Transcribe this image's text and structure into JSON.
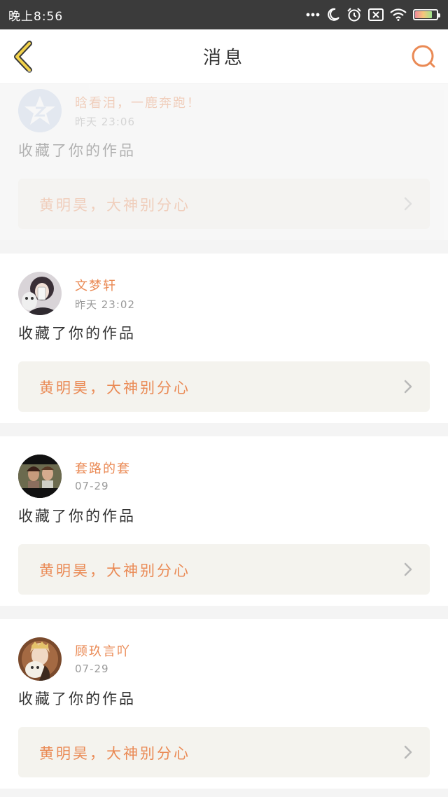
{
  "status_bar": {
    "time": "晚上8:56",
    "icons": [
      "more-dots-icon",
      "moon-icon",
      "alarm-icon",
      "sim-off-icon",
      "wifi-icon",
      "battery-icon"
    ],
    "battery_level": 0.8
  },
  "header": {
    "back_icon": "chevron-left-icon",
    "title": "消息",
    "search_icon": "search-icon"
  },
  "colors": {
    "accent": "#ea8a55",
    "back_arrow": "#f2d24b",
    "card_bg": "#ffffff",
    "work_bg": "#f4f3ee",
    "page_bg": "#f4f4f4"
  },
  "messages": [
    {
      "name": "晗看泪，一鹿奔跑！",
      "time": "昨天 23:06",
      "action": "收藏了你的作品",
      "work_title": "黄明昊，大神别分心"
    },
    {
      "name": "文梦轩",
      "time": "昨天 23:02",
      "action": "收藏了你的作品",
      "work_title": "黄明昊，大神别分心"
    },
    {
      "name": "套路的套",
      "time": "07-29",
      "action": "收藏了你的作品",
      "work_title": "黄明昊，大神别分心"
    },
    {
      "name": "顾玖言吖",
      "time": "07-29",
      "action": "收藏了你的作品",
      "work_title": "黄明昊，大神别分心"
    }
  ]
}
